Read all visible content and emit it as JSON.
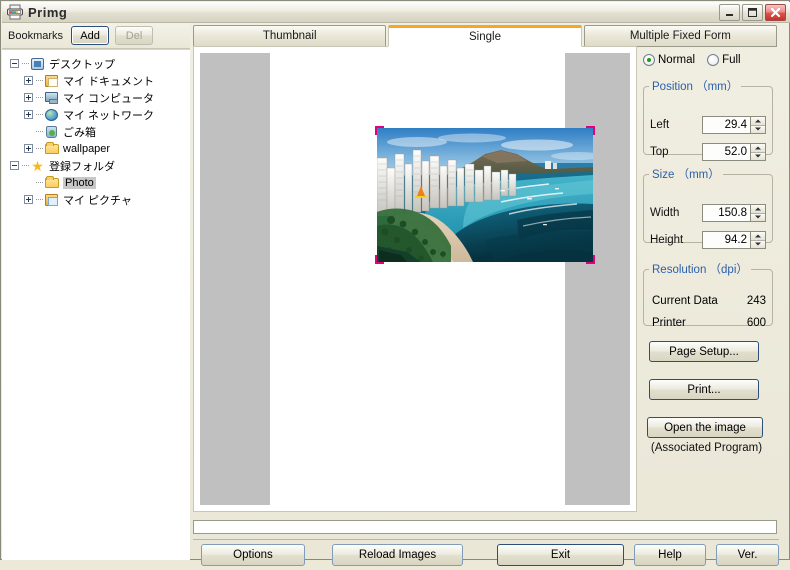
{
  "window": {
    "title": "Primg",
    "icon": "printer-icon",
    "buttons": {
      "minimize": "minimize-icon",
      "maximize": "maximize-icon",
      "close": "close-icon"
    }
  },
  "sidebar": {
    "bookmarks_label": "Bookmarks",
    "add_label": "Add",
    "del_label": "Del",
    "tree": [
      {
        "label": "デスクトップ",
        "icon": "desktop-icon",
        "indent": 0,
        "expander": "minus",
        "selected": false
      },
      {
        "label": "マイ ドキュメント",
        "icon": "documents-folder-icon",
        "indent": 1,
        "expander": "plus",
        "selected": false
      },
      {
        "label": "マイ コンピュータ",
        "icon": "my-computer-icon",
        "indent": 1,
        "expander": "plus",
        "selected": false
      },
      {
        "label": "マイ ネットワーク",
        "icon": "network-icon",
        "indent": 1,
        "expander": "plus",
        "selected": false
      },
      {
        "label": "ごみ箱",
        "icon": "recycle-bin-icon",
        "indent": 1,
        "expander": "none",
        "selected": false
      },
      {
        "label": "wallpaper",
        "icon": "folder-icon",
        "indent": 1,
        "expander": "plus",
        "selected": false
      },
      {
        "label": "登録フォルダ",
        "icon": "star-icon",
        "indent": 0,
        "expander": "minus",
        "selected": false
      },
      {
        "label": "Photo",
        "icon": "folder-open-icon",
        "indent": 1,
        "expander": "none",
        "selected": true
      },
      {
        "label": "マイ ピクチャ",
        "icon": "pictures-folder-icon",
        "indent": 1,
        "expander": "plus",
        "selected": false
      }
    ]
  },
  "tabs": [
    {
      "label": "Thumbnail",
      "active": false
    },
    {
      "label": "Single",
      "active": true
    },
    {
      "label": "Multiple Fixed Form",
      "active": false
    }
  ],
  "preview": {
    "photo_alt": "Waikiki Beach with Diamond Head",
    "crop_mark_color": "#e3007f",
    "page_background": "#ffffff",
    "surround_background": "#c0c0c0"
  },
  "controls": {
    "mode": {
      "normal_label": "Normal",
      "full_label": "Full",
      "selected": "Normal"
    },
    "position": {
      "legend": "Position （mm）",
      "left_label": "Left",
      "left_value": "29.4",
      "top_label": "Top",
      "top_value": "52.0"
    },
    "size": {
      "legend": "Size （mm）",
      "width_label": "Width",
      "width_value": "150.8",
      "height_label": "Height",
      "height_value": "94.2"
    },
    "resolution": {
      "legend": "Resolution （dpi）",
      "current_data_label": "Current Data",
      "current_data_value": "243",
      "printer_label": "Printer",
      "printer_value": "600"
    },
    "page_setup_label": "Page Setup...",
    "print_label": "Print...",
    "open_image_label": "Open the image",
    "associated_note": "(Associated Program)"
  },
  "bottom_bar": {
    "options_label": "Options",
    "reload_label": "Reload Images",
    "exit_label": "Exit",
    "help_label": "Help",
    "ver_label": "Ver."
  },
  "colors": {
    "accent_tab": "#f5a623",
    "group_legend": "#2b5fa8",
    "radio_dot": "#17a017",
    "crop_mark": "#e3007f"
  }
}
